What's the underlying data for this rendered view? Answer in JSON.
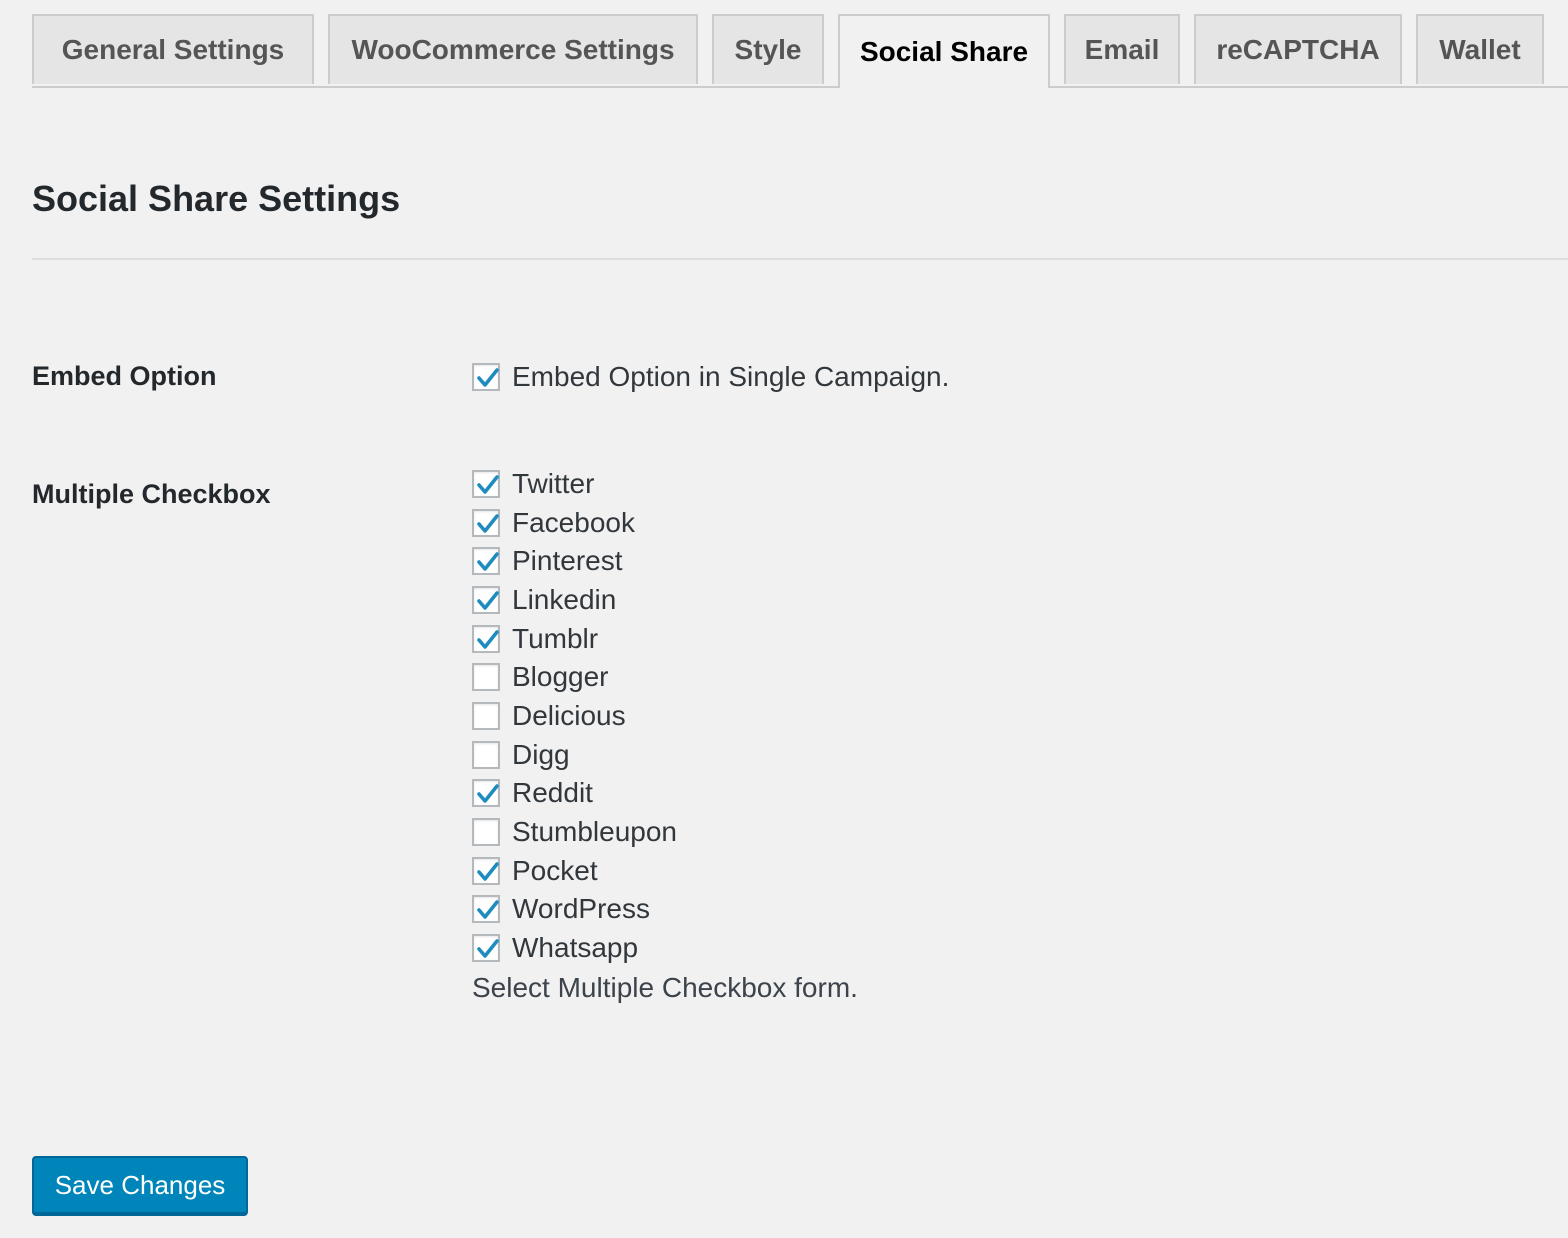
{
  "tabs": [
    {
      "label": "General Settings",
      "active": false
    },
    {
      "label": "WooCommerce Settings",
      "active": false
    },
    {
      "label": "Style",
      "active": false
    },
    {
      "label": "Social Share",
      "active": true
    },
    {
      "label": "Email",
      "active": false
    },
    {
      "label": "reCAPTCHA",
      "active": false
    },
    {
      "label": "Wallet",
      "active": false
    }
  ],
  "page_title": "Social Share Settings",
  "embed": {
    "label": "Embed Option",
    "option": {
      "label": "Embed Option in Single Campaign.",
      "checked": true
    }
  },
  "multiple": {
    "label": "Multiple Checkbox",
    "options": [
      {
        "label": "Twitter",
        "checked": true
      },
      {
        "label": "Facebook",
        "checked": true
      },
      {
        "label": "Pinterest",
        "checked": true
      },
      {
        "label": "Linkedin",
        "checked": true
      },
      {
        "label": "Tumblr",
        "checked": true
      },
      {
        "label": "Blogger",
        "checked": false
      },
      {
        "label": "Delicious",
        "checked": false
      },
      {
        "label": "Digg",
        "checked": false
      },
      {
        "label": "Reddit",
        "checked": true
      },
      {
        "label": "Stumbleupon",
        "checked": false
      },
      {
        "label": "Pocket",
        "checked": true
      },
      {
        "label": "WordPress",
        "checked": true
      },
      {
        "label": "Whatsapp",
        "checked": true
      }
    ],
    "description": "Select Multiple Checkbox form."
  },
  "save_button": {
    "label": "Save Changes"
  },
  "colors": {
    "accent": "#0085ba",
    "checkmark": "#1e8cbe",
    "background": "#f1f1f1"
  }
}
